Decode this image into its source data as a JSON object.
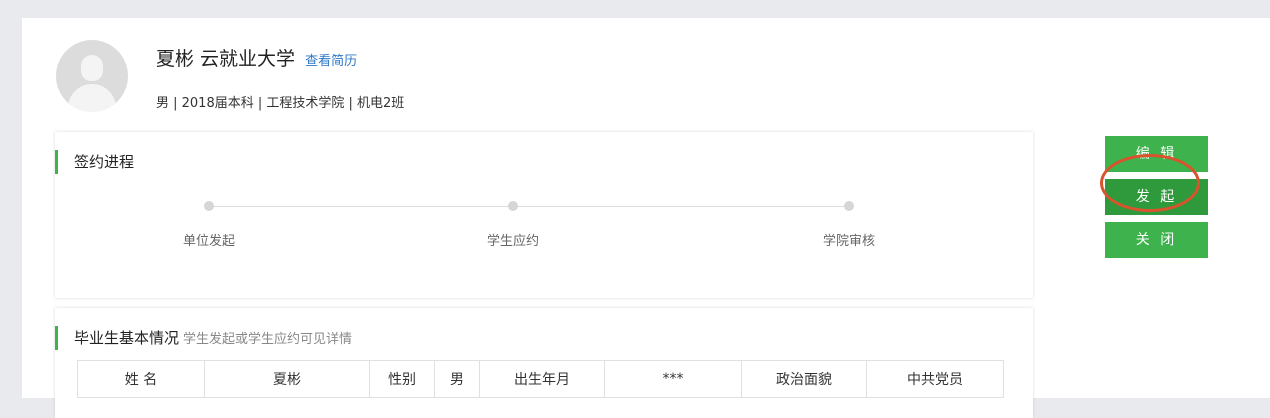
{
  "profile": {
    "name_school": "夏彬 云就业大学",
    "resume_link": "查看简历",
    "meta": "男 | 2018届本科 | 工程技术学院 | 机电2班"
  },
  "progress": {
    "title": "签约进程",
    "steps": [
      {
        "label": "单位发起"
      },
      {
        "label": "学生应约"
      },
      {
        "label": "学院审核"
      }
    ]
  },
  "basic_info": {
    "title": "毕业生基本情况",
    "subtitle": "学生发起或学生应约可见详情",
    "row": [
      "姓 名",
      "夏彬",
      "性别",
      "男",
      "出生年月",
      "***",
      "政治面貌",
      "中共党员"
    ]
  },
  "actions": {
    "edit": "编 辑",
    "initiate": "发 起",
    "close": "关 闭"
  }
}
